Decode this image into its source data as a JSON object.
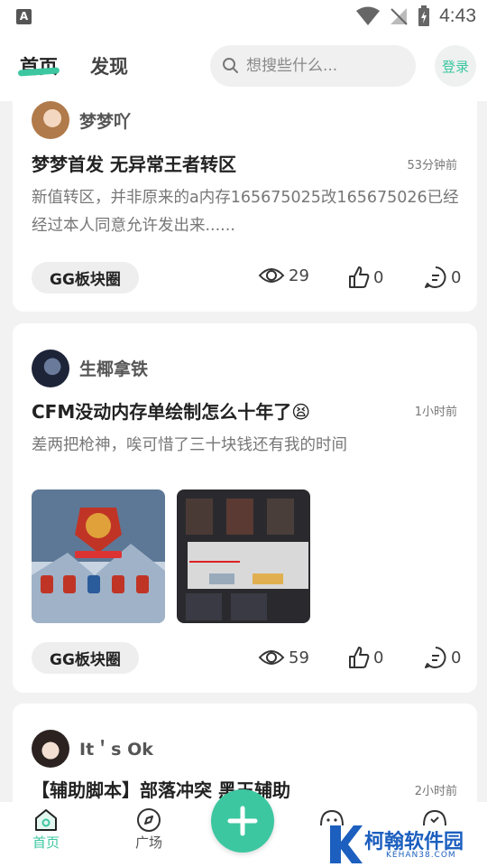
{
  "status_bar": {
    "time": "4:43",
    "left_icon": "A"
  },
  "header": {
    "tabs": [
      {
        "label": "首页"
      },
      {
        "label": "发现"
      }
    ],
    "search_placeholder": "想搜些什么...",
    "login_label": "登录"
  },
  "posts": [
    {
      "username": "梦梦吖",
      "title": "梦梦首发 无异常王者转区",
      "time": "53分钟前",
      "content": "新值转区，并非原来的a内存165675025改165675026已经经过本人同意允许发出来......",
      "tag": "GG板块圈",
      "views": "29",
      "likes": "0",
      "comments": "0"
    },
    {
      "username": "生椰拿铁",
      "title": "CFM没动内存单绘制怎么十年了😫",
      "time": "1小时前",
      "content": "差两把枪神，唉可惜了三十块钱还有我的时间",
      "tag": "GG板块圈",
      "views": "59",
      "likes": "0",
      "comments": "0"
    },
    {
      "username": "It＇s Ok",
      "title": "【辅助脚本】部落冲突 黑玉辅助",
      "time": "2小时前"
    }
  ],
  "bottom_nav": [
    {
      "label": "首页"
    },
    {
      "label": "广场"
    }
  ],
  "watermark": {
    "text": "柯翰软件园",
    "sub": "KEHAN38.COM"
  },
  "colors": {
    "accent": "#3cc7a1"
  }
}
